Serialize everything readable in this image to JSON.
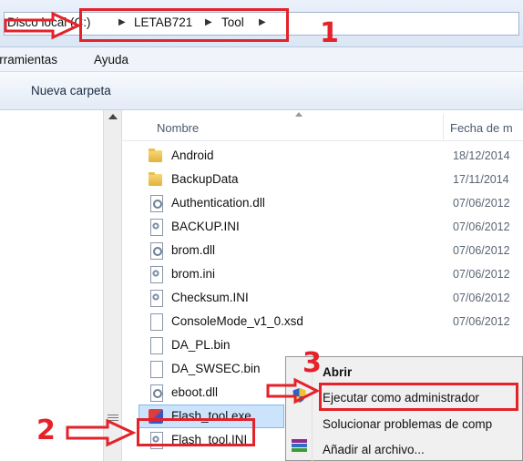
{
  "breadcrumb": {
    "root": "Disco local (C:)",
    "items": [
      "LETAB721",
      "Tool"
    ],
    "separator": "▶"
  },
  "menu": {
    "items": [
      "Herramientas",
      "Ayuda"
    ]
  },
  "toolbar": {
    "new_folder": "Nueva carpeta"
  },
  "columns": {
    "name": "Nombre",
    "date": "Fecha de m"
  },
  "files": [
    {
      "name": "Android",
      "date": "18/12/2014",
      "kind": "folder"
    },
    {
      "name": "BackupData",
      "date": "17/11/2014",
      "kind": "folder"
    },
    {
      "name": "Authentication.dll",
      "date": "07/06/2012",
      "kind": "dll"
    },
    {
      "name": "BACKUP.INI",
      "date": "07/06/2012",
      "kind": "ini"
    },
    {
      "name": "brom.dll",
      "date": "07/06/2012",
      "kind": "dll"
    },
    {
      "name": "brom.ini",
      "date": "07/06/2012",
      "kind": "ini"
    },
    {
      "name": "Checksum.INI",
      "date": "07/06/2012",
      "kind": "ini"
    },
    {
      "name": "ConsoleMode_v1_0.xsd",
      "date": "07/06/2012",
      "kind": "file"
    },
    {
      "name": "DA_PL.bin",
      "date": "",
      "kind": "file"
    },
    {
      "name": "DA_SWSEC.bin",
      "date": "",
      "kind": "file"
    },
    {
      "name": "eboot.dll",
      "date": "",
      "kind": "dll"
    },
    {
      "name": "Flash_tool.exe",
      "date": "",
      "kind": "exe",
      "selected": true
    },
    {
      "name": "Flash_tool.INI",
      "date": "",
      "kind": "ini"
    }
  ],
  "context_menu": {
    "open": "Abrir",
    "run_as_admin": "Ejecutar como administrador",
    "troubleshoot": "Solucionar problemas de comp",
    "add_to_archive": "Añadir al archivo..."
  },
  "annotations": {
    "step1": "1",
    "step2": "2",
    "step3": "3",
    "color": "#e3222a"
  }
}
